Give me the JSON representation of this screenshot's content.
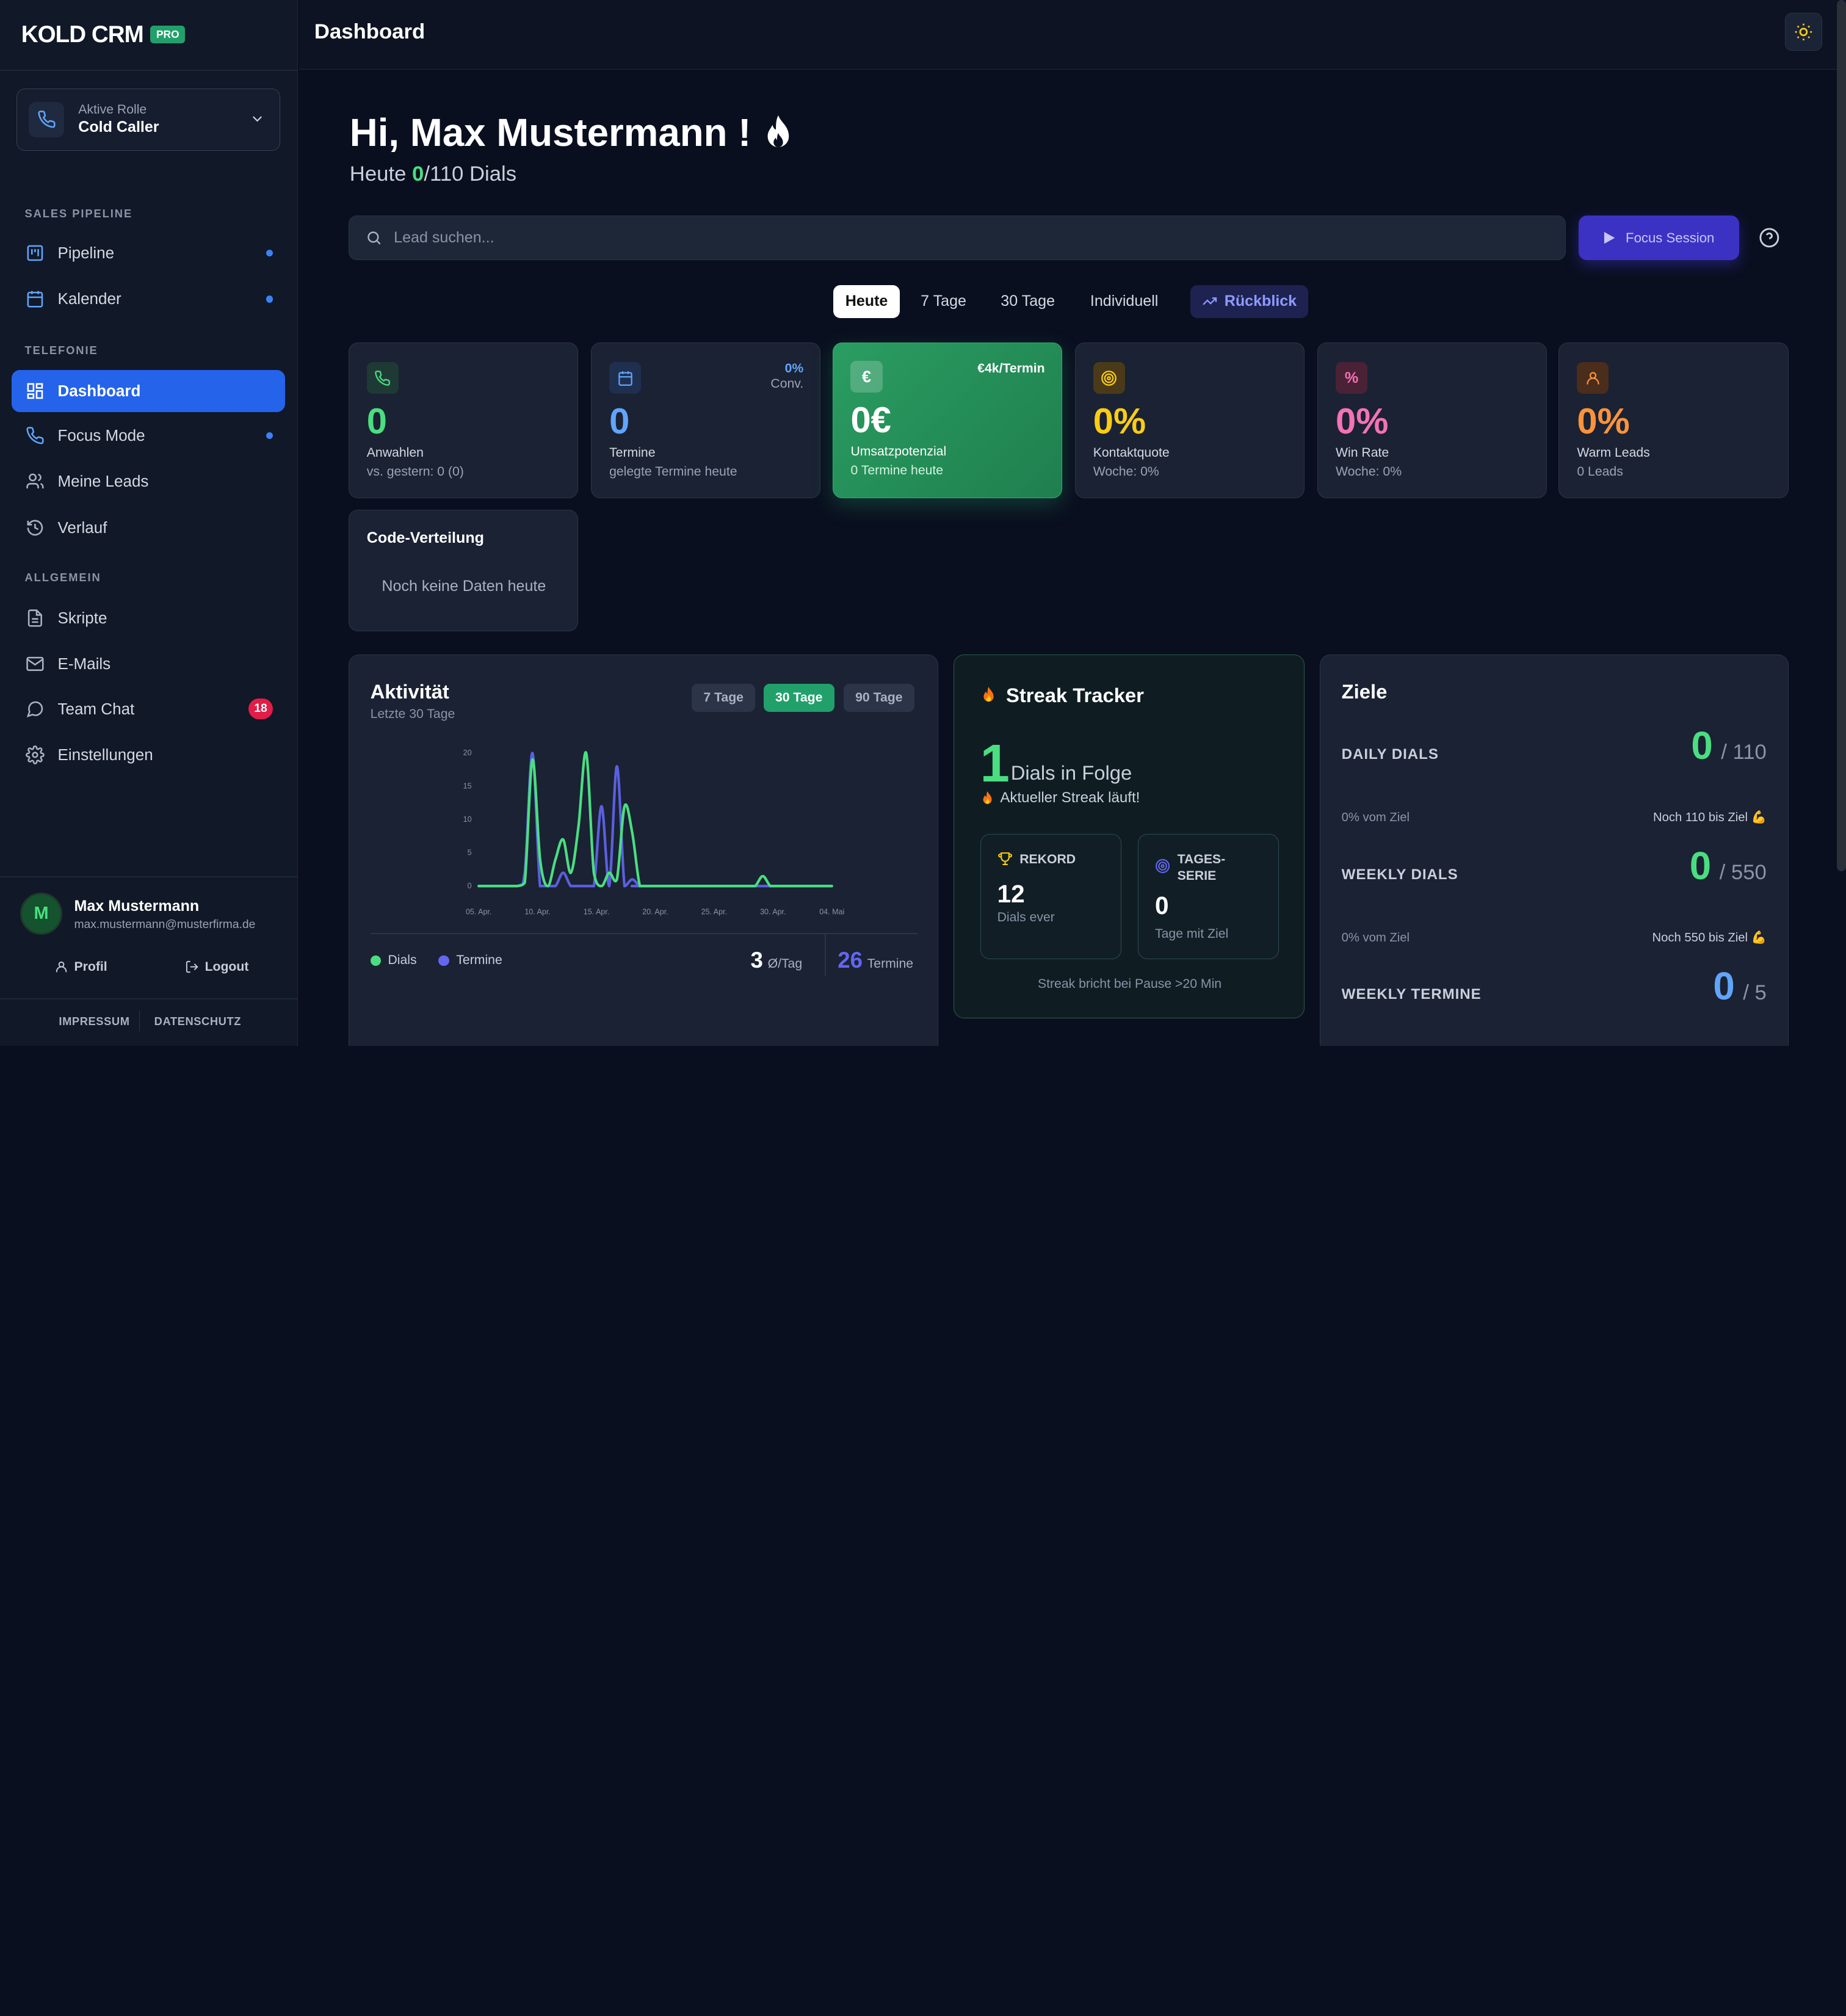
{
  "brand": {
    "name": "KOLD CRM",
    "badge": "PRO"
  },
  "role": {
    "label": "Aktive Rolle",
    "value": "Cold Caller"
  },
  "sidebar": {
    "sections": [
      "SALES PIPELINE",
      "TELEFONIE",
      "ALLGEMEIN"
    ],
    "items": [
      {
        "label": "Pipeline"
      },
      {
        "label": "Kalender"
      },
      {
        "label": "Dashboard"
      },
      {
        "label": "Focus Mode"
      },
      {
        "label": "Meine Leads"
      },
      {
        "label": "Verlauf"
      },
      {
        "label": "Skripte"
      },
      {
        "label": "E-Mails"
      },
      {
        "label": "Team Chat",
        "badge": "18"
      },
      {
        "label": "Einstellungen"
      }
    ]
  },
  "user": {
    "initial": "M",
    "name": "Max Mustermann",
    "email": "max.mustermann@musterfirma.de",
    "profile": "Profil",
    "logout": "Logout"
  },
  "legal": {
    "imprint": "IMPRESSUM",
    "privacy": "DATENSCHUTZ"
  },
  "header": {
    "title": "Dashboard"
  },
  "greeting": {
    "text": "Hi, Max Mustermann !",
    "prefix": "Heute ",
    "done": "0",
    "target": "/110 Dials"
  },
  "search": {
    "placeholder": "Lead suchen..."
  },
  "focus_button": "Focus Session",
  "range_tabs": [
    "Heute",
    "7 Tage",
    "30 Tage",
    "Individuell",
    "Rückblick"
  ],
  "kpis": [
    {
      "value": "0",
      "label": "Anwahlen",
      "sub": "vs. gestern: 0 (0)",
      "color": "#4ade80"
    },
    {
      "value": "0",
      "label": "Termine",
      "sub": "gelegte Termine heute",
      "corner_top": "0%",
      "corner_bottom": "Conv.",
      "color": "#60a5fa"
    },
    {
      "value": "0€",
      "label": "Umsatzpotenzial",
      "sub": "0 Termine heute",
      "corner_top": "€4k/Termin",
      "color": "#ffffff"
    },
    {
      "value": "0%",
      "label": "Kontaktquote",
      "sub": "Woche: 0%",
      "color": "#facc15"
    },
    {
      "value": "0%",
      "label": "Win Rate",
      "sub": "Woche: 0%",
      "color": "#f472b6"
    },
    {
      "value": "0%",
      "label": "Warm Leads",
      "sub": "0 Leads",
      "color": "#fb923c"
    }
  ],
  "code_distribution": {
    "title": "Code-Verteilung",
    "empty": "Noch keine Daten heute"
  },
  "activity": {
    "title": "Aktivität",
    "subtitle": "Letzte 30 Tage",
    "tabs": [
      "7 Tage",
      "30 Tage",
      "90 Tage"
    ],
    "avg_value": "3",
    "avg_unit": "Ø/Tag",
    "total_value": "26",
    "total_unit": "Termine"
  },
  "chart_data": {
    "type": "line",
    "x": [
      "05. Apr.",
      "10. Apr.",
      "15. Apr.",
      "20. Apr.",
      "25. Apr.",
      "30. Apr.",
      "04. Mai"
    ],
    "yticks": [
      0,
      5,
      10,
      15,
      20
    ],
    "ylim": [
      0,
      20
    ],
    "grid": false,
    "legend": "bottom-left",
    "series": [
      {
        "name": "Dials",
        "color": "#4ade80",
        "points": [
          [
            0,
            0
          ],
          [
            2,
            0
          ],
          [
            3,
            0
          ],
          [
            4,
            0
          ],
          [
            5,
            0
          ],
          [
            6,
            0.5
          ],
          [
            7,
            19
          ],
          [
            8,
            4
          ],
          [
            9,
            0
          ],
          [
            10,
            4
          ],
          [
            11,
            7
          ],
          [
            12,
            2
          ],
          [
            13,
            9
          ],
          [
            14,
            20
          ],
          [
            15,
            2
          ],
          [
            16,
            0
          ],
          [
            17,
            2
          ],
          [
            18,
            1
          ],
          [
            19,
            12
          ],
          [
            20,
            8
          ],
          [
            21,
            0
          ],
          [
            22,
            0
          ],
          [
            23,
            0
          ],
          [
            24,
            0
          ],
          [
            25,
            0
          ],
          [
            26,
            0
          ],
          [
            27,
            0
          ],
          [
            28,
            0
          ],
          [
            29,
            0
          ],
          [
            30,
            0
          ],
          [
            31,
            0
          ],
          [
            32,
            0
          ],
          [
            33,
            0
          ],
          [
            34,
            0
          ],
          [
            35,
            0
          ],
          [
            36,
            0
          ],
          [
            37,
            1.5
          ],
          [
            38,
            0
          ],
          [
            39,
            0
          ],
          [
            40,
            0
          ],
          [
            41,
            0
          ],
          [
            42,
            0
          ],
          [
            43,
            0
          ],
          [
            44,
            0
          ],
          [
            45,
            0
          ],
          [
            46,
            0
          ]
        ]
      },
      {
        "name": "Termine",
        "color": "#6366f1",
        "points": [
          [
            0,
            0
          ],
          [
            5,
            0
          ],
          [
            6,
            2
          ],
          [
            7,
            20
          ],
          [
            8,
            0
          ],
          [
            9,
            0
          ],
          [
            10,
            0
          ],
          [
            11,
            2
          ],
          [
            12,
            0
          ],
          [
            13,
            0
          ],
          [
            14,
            0
          ],
          [
            15,
            0
          ],
          [
            16,
            12
          ],
          [
            17,
            0
          ],
          [
            18,
            18
          ],
          [
            19,
            0
          ],
          [
            20,
            1
          ],
          [
            21,
            0
          ],
          [
            22,
            0
          ],
          [
            46,
            0
          ]
        ]
      }
    ]
  },
  "streak": {
    "title": "Streak Tracker",
    "count": "1",
    "unit": "Dials in Folge",
    "live": "Aktueller Streak läuft!",
    "record_label": "REKORD",
    "record_value": "12",
    "record_sub": "Dials ever",
    "day_label_1": "TAGES-",
    "day_label_2": "SERIE",
    "day_value": "0",
    "day_sub": "Tage mit Ziel",
    "footer": "Streak bricht bei Pause >20 Min"
  },
  "goals": {
    "title": "Ziele",
    "items": [
      {
        "label": "DAILY DIALS",
        "value": "0",
        "target": "/ 110",
        "pct": "0% vom Ziel",
        "remaining": "Noch 110 bis Ziel",
        "color": "#4ade80"
      },
      {
        "label": "WEEKLY DIALS",
        "value": "0",
        "target": "/ 550",
        "pct": "0% vom Ziel",
        "remaining": "Noch 550 bis Ziel",
        "color": "#4ade80"
      },
      {
        "label": "WEEKLY TERMINE",
        "value": "0",
        "target": "/ 5",
        "color": "#60a5fa"
      }
    ]
  }
}
